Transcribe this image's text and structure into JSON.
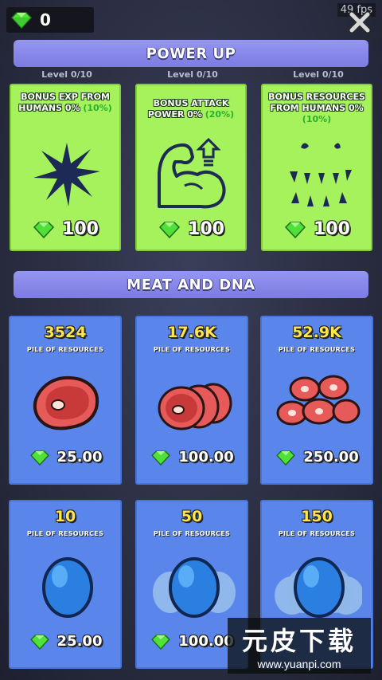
{
  "hud": {
    "gem_count": "0",
    "fps": "49 fps"
  },
  "power_up": {
    "header": "POWER UP",
    "cards": [
      {
        "level": "Level 0/10",
        "title": "BONUS EXP FROM HUMANS 0%",
        "bonus": "(10%)",
        "price": "100",
        "icon": "burst-icon"
      },
      {
        "level": "Level 0/10",
        "title": "BONUS ATTACK POWER 0%",
        "bonus": "(20%)",
        "price": "100",
        "icon": "flexed-arm-icon"
      },
      {
        "level": "Level 0/10",
        "title": "BONUS RESOURCES FROM HUMANS 0%",
        "bonus": "(10%)",
        "price": "100",
        "icon": "monster-mouth-icon"
      }
    ]
  },
  "meat_dna": {
    "header": "MEAT AND DNA",
    "cards": [
      {
        "amount": "3524",
        "label": "PILE OF RESOURCES",
        "price": "25.00",
        "icon": "steak-icon"
      },
      {
        "amount": "17.6K",
        "label": "PILE OF RESOURCES",
        "price": "100.00",
        "icon": "steak-stack-icon"
      },
      {
        "amount": "52.9K",
        "label": "PILE OF RESOURCES",
        "price": "250.00",
        "icon": "steak-pile-icon"
      },
      {
        "amount": "10",
        "label": "PILE OF RESOURCES",
        "price": "25.00",
        "icon": "dna-egg-icon"
      },
      {
        "amount": "50",
        "label": "PILE OF RESOURCES",
        "price": "100.00",
        "icon": "dna-egg-cloud-icon"
      },
      {
        "amount": "150",
        "label": "PILE OF RESOURCES",
        "price": "",
        "icon": "dna-egg-cloud-large-icon"
      }
    ]
  },
  "watermark": {
    "title": "元皮下载",
    "url": "www.yuanpi.com"
  },
  "colors": {
    "header_purple": "#8a8aee",
    "powerup_green": "#a6f25c",
    "resource_blue": "#5a86ec",
    "amount_yellow": "#ffe64a",
    "gem_green": "#4fe03a"
  }
}
